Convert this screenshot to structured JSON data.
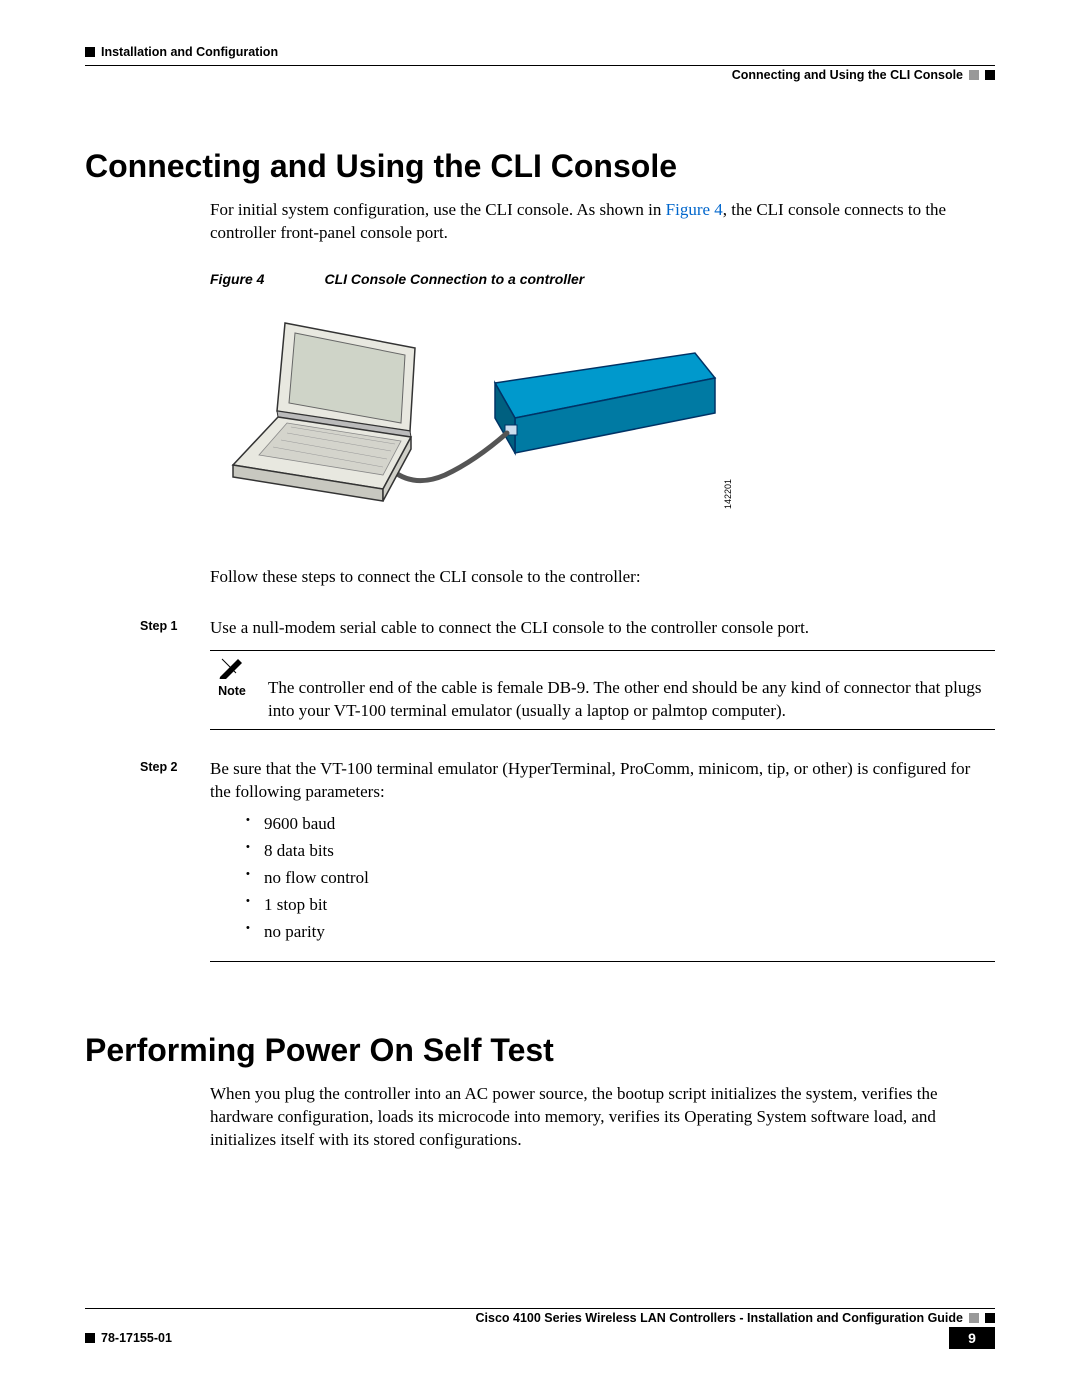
{
  "header": {
    "chapter": "Installation and Configuration",
    "section": "Connecting and Using the CLI Console"
  },
  "section1": {
    "title": "Connecting and Using the CLI Console",
    "intro_before": "For initial system configuration, use the CLI console. As shown in ",
    "figref": "Figure 4",
    "intro_after": ", the CLI console connects to the controller front-panel console port.",
    "fig_label": "Figure 4",
    "fig_caption": "CLI Console Connection to a controller",
    "fig_id": "142201",
    "follow": "Follow these steps to connect the CLI console to the controller:",
    "step1_label": "Step 1",
    "step1_text": "Use a null-modem serial cable to connect the CLI console to the controller console port.",
    "note_label": "Note",
    "note_text": "The controller end of the cable is female DB-9. The other end should be any kind of connector that plugs into your VT-100 terminal emulator (usually a laptop or palmtop computer).",
    "step2_label": "Step 2",
    "step2_text": "Be sure that the VT-100 terminal emulator (HyperTerminal, ProComm, minicom, tip, or other) is configured for the following parameters:",
    "bullets": {
      "b0": "9600 baud",
      "b1": "8 data bits",
      "b2": "no flow control",
      "b3": "1 stop bit",
      "b4": "no parity"
    }
  },
  "section2": {
    "title": "Performing Power On Self Test",
    "para": "When you plug the controller into an AC power source, the bootup script initializes the system, verifies the hardware configuration, loads its microcode into memory, verifies its Operating System software load, and initializes itself with its stored configurations."
  },
  "footer": {
    "guide": "Cisco 4100 Series Wireless LAN Controllers - Installation and Configuration Guide",
    "docnum": "78-17155-01",
    "page": "9"
  }
}
